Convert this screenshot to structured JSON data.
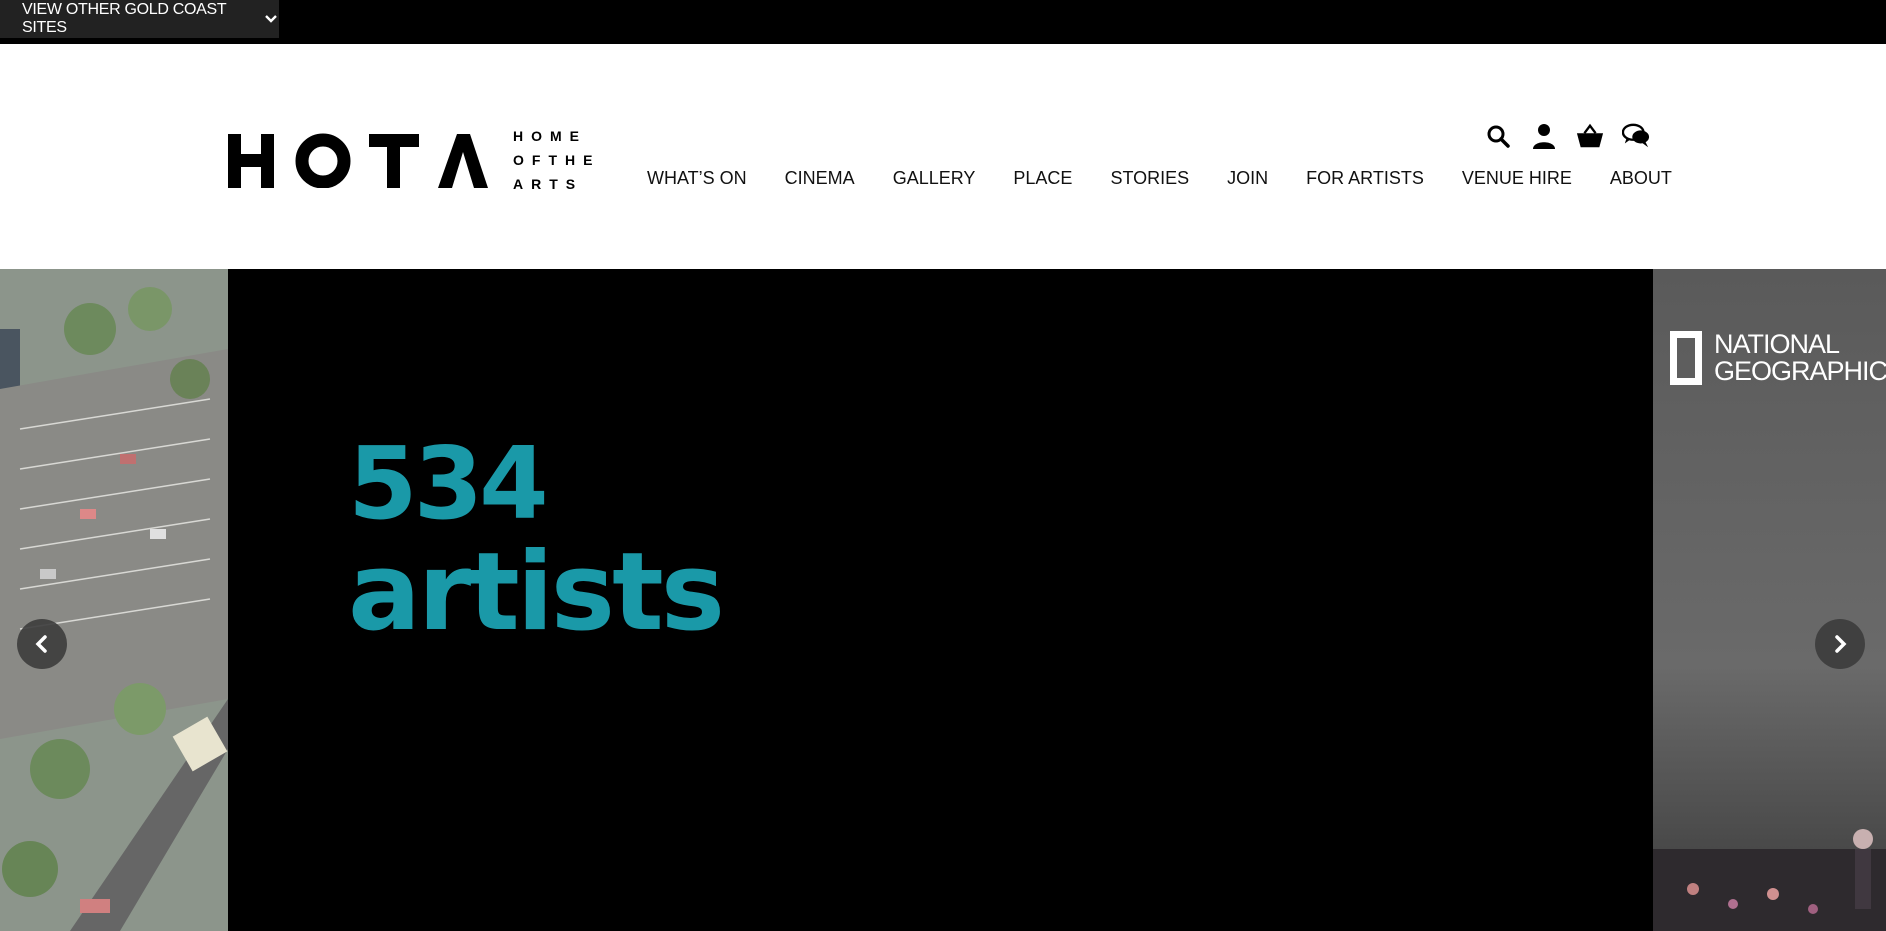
{
  "topbar": {
    "sites_label": "VIEW OTHER GOLD COAST SITES"
  },
  "logo": {
    "word": "HOTA",
    "sub_lines": [
      "HOME",
      "OFTHE",
      "ARTS"
    ]
  },
  "header_icons": [
    "search-icon",
    "account-icon",
    "cart-icon",
    "chat-icon"
  ],
  "nav": {
    "items": [
      "WHAT’S ON",
      "CINEMA",
      "GALLERY",
      "PLACE",
      "STORIES",
      "JOIN",
      "FOR ARTISTS",
      "VENUE HIRE",
      "ABOUT"
    ]
  },
  "hero": {
    "stat_number": "534",
    "stat_word": "artists",
    "accent_color": "#1a99a8",
    "right_slide_logo": [
      "NATIONAL",
      "GEOGRAPHIC"
    ]
  }
}
